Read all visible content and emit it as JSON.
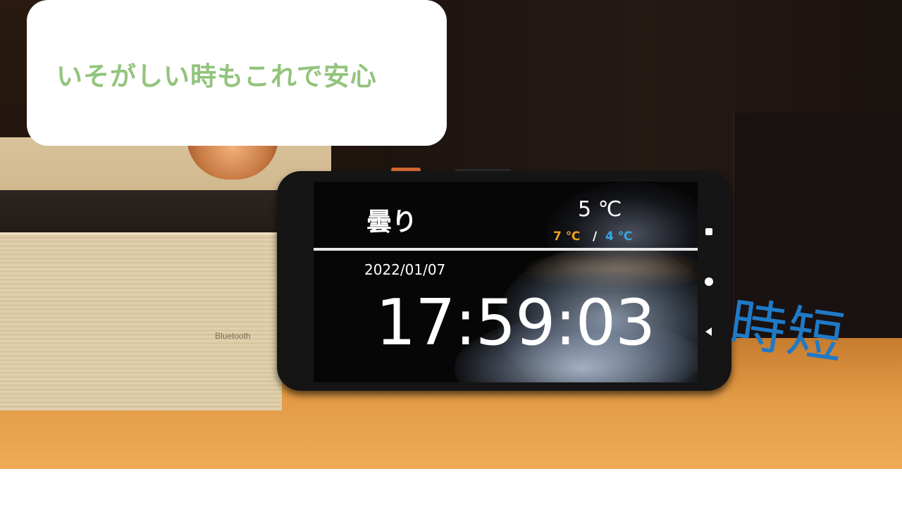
{
  "caption": "いそがしい時もこれで安心",
  "side_label": "時短",
  "speaker": {
    "brand_label": "Bluetooth"
  },
  "phone_screen": {
    "weather": "曇り",
    "temperature": "5 ℃",
    "temp_high": "7 ℃",
    "temp_separator": "/",
    "temp_low": "4 ℃",
    "date": "2022/01/07",
    "time": "17:59:03",
    "colors": {
      "high": "#f0a020",
      "low": "#39a8e6"
    },
    "nav_icons": [
      "square-icon",
      "circle-icon",
      "back-triangle-icon"
    ]
  },
  "colors": {
    "caption_text": "#93c47d",
    "side_label": "#1f7ac8"
  }
}
